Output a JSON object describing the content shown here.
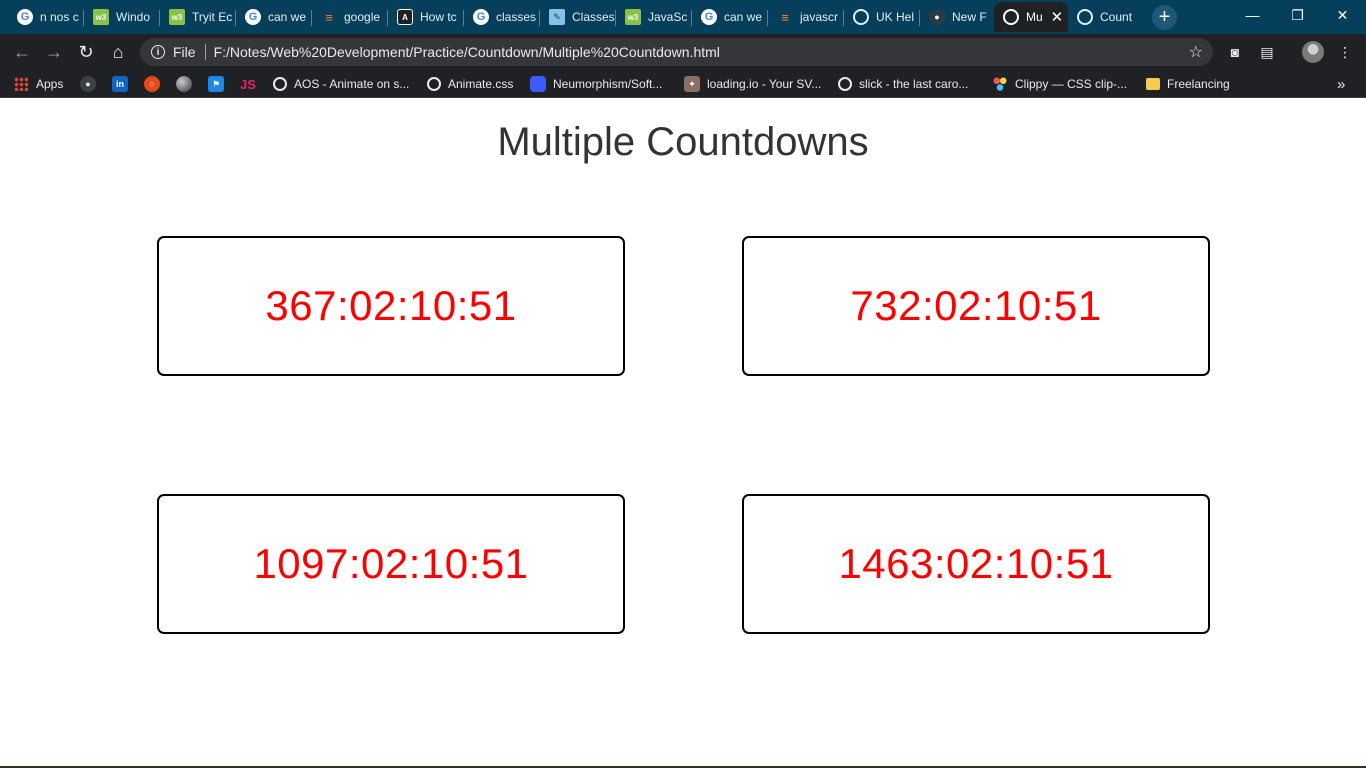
{
  "tabs": [
    {
      "title": "n nos c",
      "icon": "google-icon"
    },
    {
      "title": "Windo",
      "icon": "w3schools-icon"
    },
    {
      "title": "Tryit Ec",
      "icon": "w3schools-icon"
    },
    {
      "title": "can we",
      "icon": "google-icon"
    },
    {
      "title": "google",
      "icon": "stackoverflow-icon"
    },
    {
      "title": "How tc",
      "icon": "angular-icon"
    },
    {
      "title": "classes",
      "icon": "google-icon"
    },
    {
      "title": "Classes",
      "icon": "pen-icon"
    },
    {
      "title": "JavaSc",
      "icon": "w3schools-icon"
    },
    {
      "title": "can we",
      "icon": "google-icon"
    },
    {
      "title": "javascr",
      "icon": "stackoverflow-icon"
    },
    {
      "title": "UK Hel",
      "icon": "globe-icon"
    },
    {
      "title": "New F",
      "icon": "github-icon"
    },
    {
      "title": "Mu",
      "icon": "globe-icon",
      "active": true
    },
    {
      "title": "Count",
      "icon": "globe-icon"
    }
  ],
  "toolbar": {
    "file_label": "File",
    "url": "F:/Notes/Web%20Development/Practice/Countdown/Multiple%20Countdown.html"
  },
  "bookmarks": {
    "apps": "Apps",
    "items": [
      {
        "label": "AOS - Animate on s...",
        "icon": "globe-icon"
      },
      {
        "label": "Animate.css",
        "icon": "globe-icon"
      },
      {
        "label": "Neumorphism/Soft...",
        "icon": "neumorphism-icon"
      },
      {
        "label": "loading.io - Your SV...",
        "icon": "loading-io-icon"
      },
      {
        "label": "slick - the last caro...",
        "icon": "globe-icon"
      },
      {
        "label": "Clippy — CSS clip-...",
        "icon": "clippy-icon"
      },
      {
        "label": "Freelancing",
        "icon": "folder-icon"
      }
    ],
    "more": "»"
  },
  "page": {
    "title": "Multiple Countdowns",
    "countdowns": [
      {
        "time": "367:02:10:51"
      },
      {
        "time": "732:02:10:51"
      },
      {
        "time": "1097:02:10:51"
      },
      {
        "time": "1463:02:10:51"
      }
    ]
  },
  "colors": {
    "countdown_text": "#ff0000",
    "tabstrip_bg": "#063f5b",
    "toolbar_bg": "#202124"
  }
}
